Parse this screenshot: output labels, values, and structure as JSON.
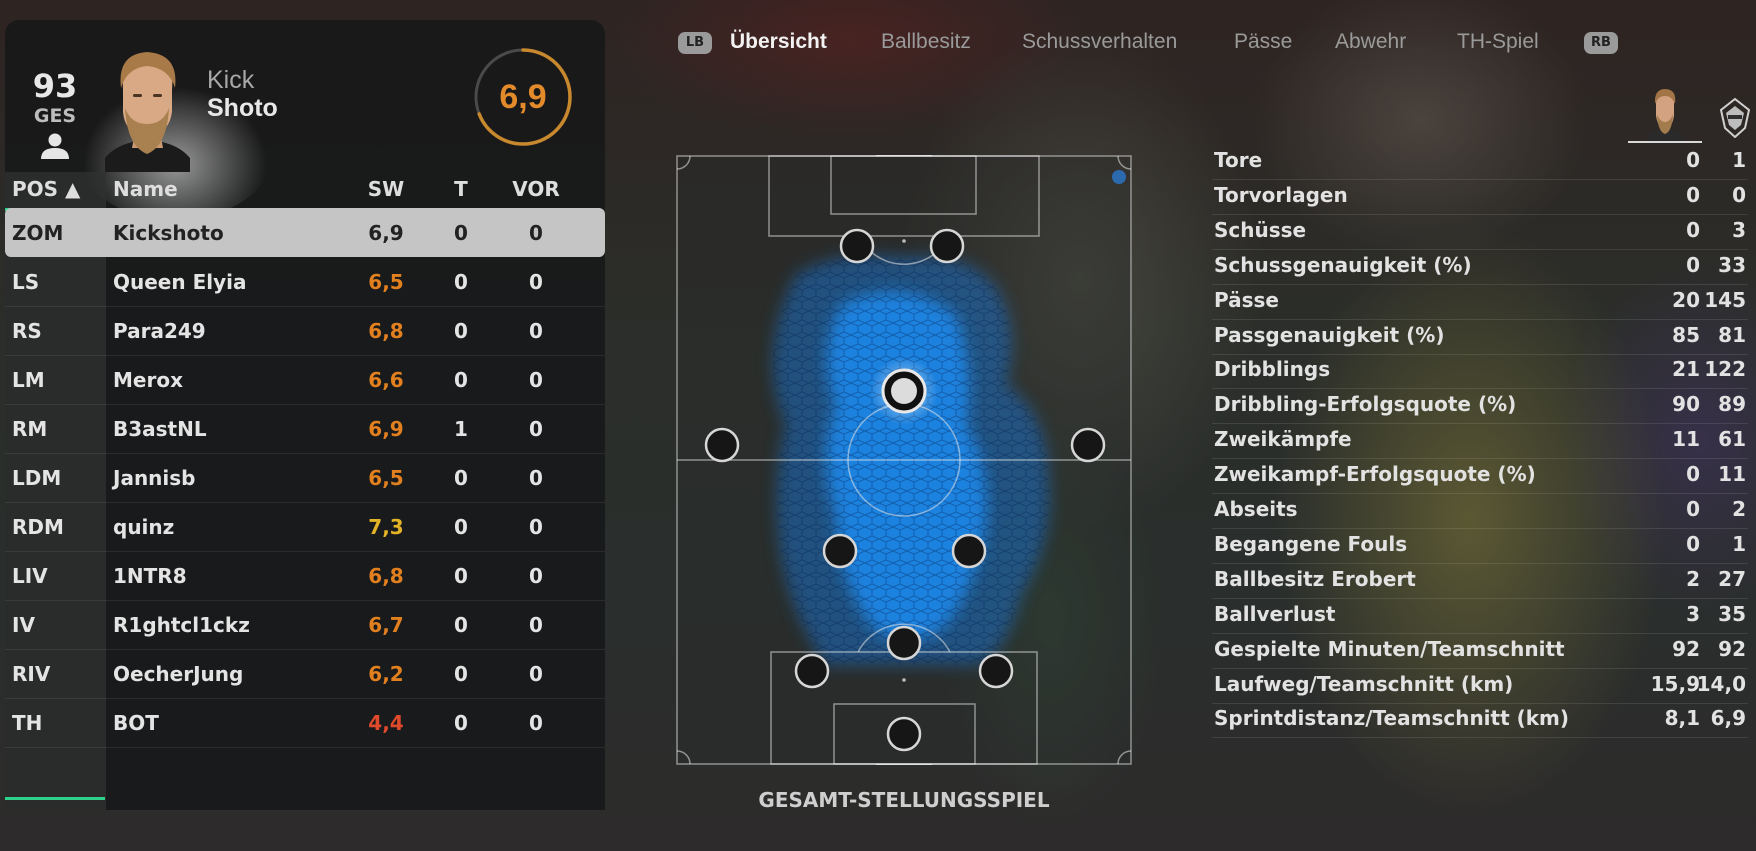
{
  "player": {
    "overall": "93",
    "overall_label": "GES",
    "first_name": "Kick",
    "last_name": "Shoto",
    "match_rating": "6,9",
    "match_rating_fraction": 0.69
  },
  "table": {
    "headers": {
      "pos": "POS ▲",
      "name": "Name",
      "sw": "SW",
      "t": "T",
      "vor": "VOR"
    },
    "rows": [
      {
        "pos": "ZOM",
        "name": "Kickshoto",
        "sw": "6,9",
        "t": "0",
        "vor": "0",
        "sw_color": "#e6e6e6"
      },
      {
        "pos": "LS",
        "name": "Queen Elyia",
        "sw": "6,5",
        "t": "0",
        "vor": "0",
        "sw_color": "#e2801f"
      },
      {
        "pos": "RS",
        "name": "Para249",
        "sw": "6,8",
        "t": "0",
        "vor": "0",
        "sw_color": "#e2801f"
      },
      {
        "pos": "LM",
        "name": "Merox",
        "sw": "6,6",
        "t": "0",
        "vor": "0",
        "sw_color": "#e2801f"
      },
      {
        "pos": "RM",
        "name": "B3astNL",
        "sw": "6,9",
        "t": "1",
        "vor": "0",
        "sw_color": "#e2801f"
      },
      {
        "pos": "LDM",
        "name": "Jannisb",
        "sw": "6,5",
        "t": "0",
        "vor": "0",
        "sw_color": "#e2801f"
      },
      {
        "pos": "RDM",
        "name": "quinz",
        "sw": "7,3",
        "t": "0",
        "vor": "0",
        "sw_color": "#e2b327"
      },
      {
        "pos": "LIV",
        "name": "1NTR8",
        "sw": "6,8",
        "t": "0",
        "vor": "0",
        "sw_color": "#e2801f"
      },
      {
        "pos": "IV",
        "name": "R1ghtcl1ckz",
        "sw": "6,7",
        "t": "0",
        "vor": "0",
        "sw_color": "#e2801f"
      },
      {
        "pos": "RIV",
        "name": "OecherJung",
        "sw": "6,2",
        "t": "0",
        "vor": "0",
        "sw_color": "#e2801f"
      },
      {
        "pos": "TH",
        "name": "BOT",
        "sw": "4,4",
        "t": "0",
        "vor": "0",
        "sw_color": "#e04a2c"
      }
    ]
  },
  "tabs": {
    "left_badge": "LB",
    "right_badge": "RB",
    "items": [
      "Übersicht",
      "Ballbesitz",
      "Schussverhalten",
      "Pässe",
      "Abwehr",
      "TH-Spiel"
    ],
    "active_index": 0
  },
  "pitch": {
    "caption": "GESAMT-STELLUNGSSPIEL"
  },
  "stats": [
    {
      "label": "Tore",
      "player": "0",
      "team": "1"
    },
    {
      "label": "Torvorlagen",
      "player": "0",
      "team": "0"
    },
    {
      "label": "Schüsse",
      "player": "0",
      "team": "3"
    },
    {
      "label": "Schussgenauigkeit (%)",
      "player": "0",
      "team": "33"
    },
    {
      "label": "Pässe",
      "player": "20",
      "team": "145"
    },
    {
      "label": "Passgenauigkeit (%)",
      "player": "85",
      "team": "81"
    },
    {
      "label": "Dribblings",
      "player": "21",
      "team": "122"
    },
    {
      "label": "Dribbling-Erfolgsquote (%)",
      "player": "90",
      "team": "89"
    },
    {
      "label": "Zweikämpfe",
      "player": "11",
      "team": "61"
    },
    {
      "label": "Zweikampf-Erfolgsquote (%)",
      "player": "0",
      "team": "11"
    },
    {
      "label": "Abseits",
      "player": "0",
      "team": "2"
    },
    {
      "label": "Begangene Fouls",
      "player": "0",
      "team": "1"
    },
    {
      "label": "Ballbesitz Erobert",
      "player": "2",
      "team": "27"
    },
    {
      "label": "Ballverlust",
      "player": "3",
      "team": "35"
    },
    {
      "label": "Gespielte Minuten/Teamschnitt",
      "player": "92",
      "team": "92"
    },
    {
      "label": "Laufweg/Teamschnitt (km)",
      "player": "15,9",
      "team": "14,0"
    },
    {
      "label": "Sprintdistanz/Teamschnitt (km)",
      "player": "8,1",
      "team": "6,9"
    }
  ],
  "colors": {
    "accent_green": "#2fd18a",
    "rating_orange": "#e38a2a",
    "heatmap_blue": "#1a8bf0"
  }
}
